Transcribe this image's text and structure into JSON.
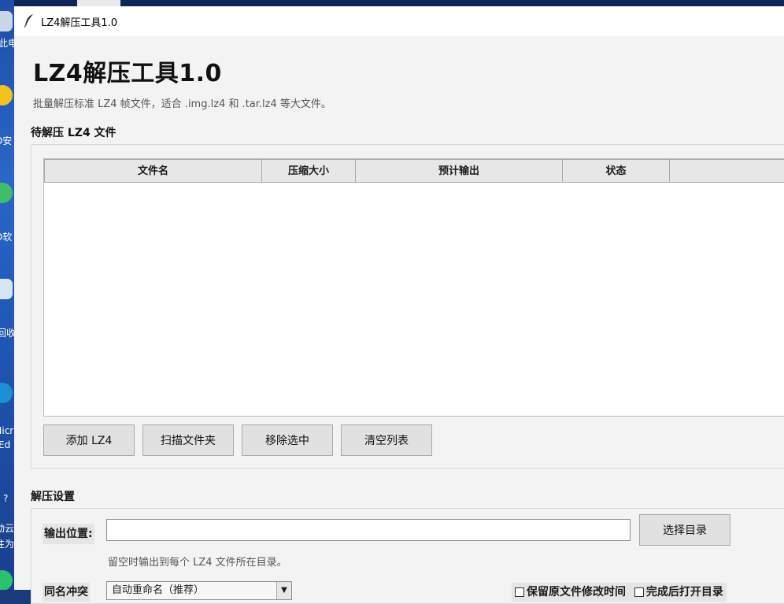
{
  "desktop": {
    "labels": [
      "此电",
      "D安",
      "D软",
      "回收",
      "Micr",
      "Ed",
      "?",
      "动云",
      "注为"
    ]
  },
  "window": {
    "title": "LZ4解压工具1.0"
  },
  "app": {
    "heading": "LZ4解压工具1.0",
    "subtitle": "批量解压标准 LZ4 帧文件，适合 .img.lz4 和 .tar.lz4 等大文件。"
  },
  "files_section": {
    "label": "待解压 LZ4 文件",
    "columns": [
      "文件名",
      "压缩大小",
      "预计输出",
      "状态",
      ""
    ],
    "rows": [],
    "buttons": {
      "add": "添加 LZ4",
      "scan": "扫描文件夹",
      "remove": "移除选中",
      "clear": "清空列表"
    }
  },
  "settings_section": {
    "label": "解压设置",
    "output_label": "输出位置:",
    "output_value": "",
    "choose_dir": "选择目录",
    "output_hint": "留空时输出到每个 LZ4 文件所在目录。",
    "rename_label": "同名冲突",
    "rename_value": "自动重命名（推荐）",
    "keep_mtime": "保留原文件修改时间",
    "open_after": "完成后打开目录"
  }
}
